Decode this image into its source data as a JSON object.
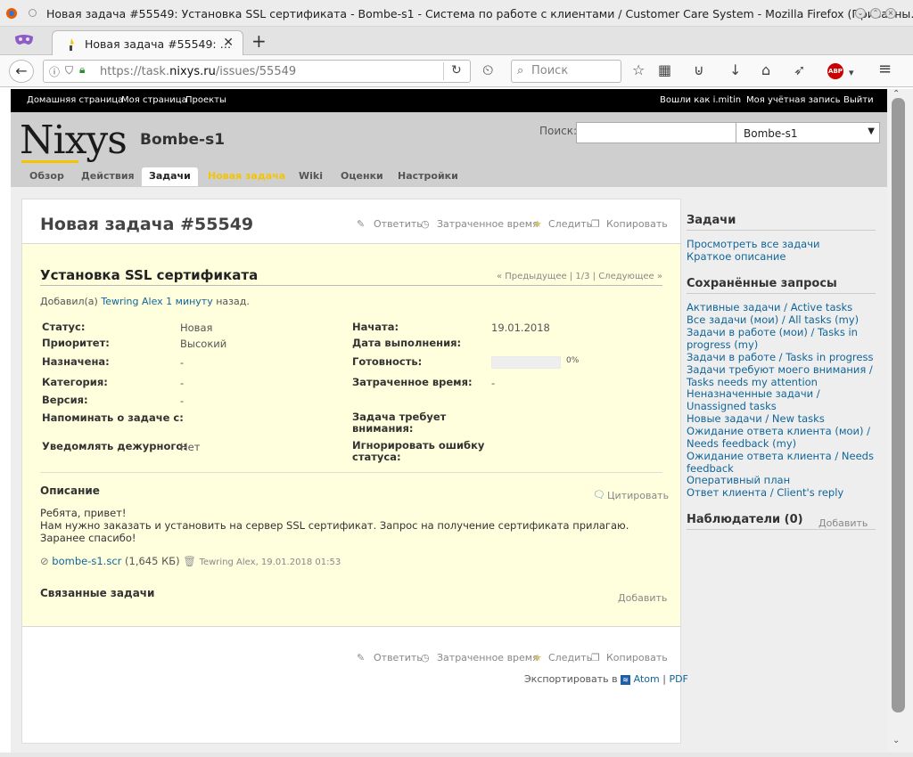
{
  "window": {
    "title": "Новая задача #55549: Установка SSL сертификата - Bombe-s1 - Система по работе с клиентами / Customer Care System - Mozilla Firefox (Приватны…"
  },
  "browser": {
    "tab_title": "Новая задача #55549: …",
    "url_prefix": "https://task.",
    "url_domain": "nixys.ru",
    "url_path": "/issues/55549",
    "search_placeholder": "Поиск"
  },
  "topmenu": {
    "left": [
      "Домашняя страница",
      "Моя страница",
      "Проекты"
    ],
    "logged_in": "Вошли как i.mitin",
    "account": "Моя учётная запись",
    "logout": "Выйти"
  },
  "header": {
    "logo": "Nixys",
    "project": "Bombe-s1",
    "search_label": "Поиск:",
    "project_select": "Bombe-s1",
    "tabs": [
      "Обзор",
      "Действия",
      "Задачи",
      "Новая задача",
      "Wiki",
      "Оценки",
      "Настройки"
    ],
    "colors": {
      "accent": "#f5c400",
      "header_bg": "#cfcfcf"
    }
  },
  "issue": {
    "title": "Новая задача #55549",
    "tools": {
      "reply": "Ответить",
      "time": "Затраченное время",
      "watch": "Следить",
      "copy": "Копировать"
    },
    "subject": "Установка SSL сертификата",
    "nav": "« Предыдущее | 1/3 | Следующее »",
    "added_prefix": "Добавил(а)",
    "author": "Tewring Alex",
    "time_ago": "1 минуту",
    "added_suffix": "назад.",
    "attributes": {
      "status_label": "Статус:",
      "status_value": "Новая",
      "priority_label": "Приоритет:",
      "priority_value": "Высокий",
      "assigned_label": "Назначена:",
      "assigned_value": "-",
      "category_label": "Категория:",
      "category_value": "-",
      "version_label": "Версия:",
      "version_value": "-",
      "remind_label": "Напоминать о задаче с:",
      "notify_label": "Уведомлять дежурного:",
      "notify_value": "Нет",
      "start_label": "Начата:",
      "start_value": "19.01.2018",
      "due_label": "Дата выполнения:",
      "done_label": "Готовность:",
      "done_value": "0%",
      "spent_label": "Затраченное время:",
      "spent_value": "-",
      "attention_label": "Задача требует внимания:",
      "ignore_label": "Игнорировать ошибку статуса:"
    },
    "done_ratio": 0,
    "description_title": "Описание",
    "quote": "Цитировать",
    "description_lines": [
      "Ребята, привет!",
      "Нам нужно заказать и установить на сервер SSL сертификат. Запрос на получение сертификата прилагаю.",
      "Заранее спасибо!"
    ],
    "attachment": {
      "name": "bombe-s1.scr",
      "size": "(1,645 КБ)",
      "meta": "Tewring Alex, 19.01.2018 01:53"
    },
    "related_title": "Связанные задачи",
    "related_add": "Добавить",
    "export_label": "Экспортировать в",
    "export_atom": "Atom",
    "export_pdf": "PDF"
  },
  "sidebar": {
    "issues_title": "Задачи",
    "issues_links": [
      "Просмотреть все задачи",
      "Краткое описание"
    ],
    "queries_title": "Сохранённые запросы",
    "queries": [
      "Активные задачи / Active tasks",
      "Все задачи (мои) / All tasks (my)",
      "Задачи в работе (мои) / Tasks in progress (my)",
      "Задачи в работе / Tasks in progress",
      "Задачи требуют моего внимания / Tasks needs my attention",
      "Неназначенные задачи / Unassigned tasks",
      "Новые задачи / New tasks",
      "Ожидание ответа клиента (мои) / Needs feedback (my)",
      "Ожидание ответа клиента / Needs feedback",
      "Оперативный план",
      "Ответ клиента / Client's reply"
    ],
    "watchers_title": "Наблюдатели (0)",
    "watchers_add": "Добавить"
  }
}
